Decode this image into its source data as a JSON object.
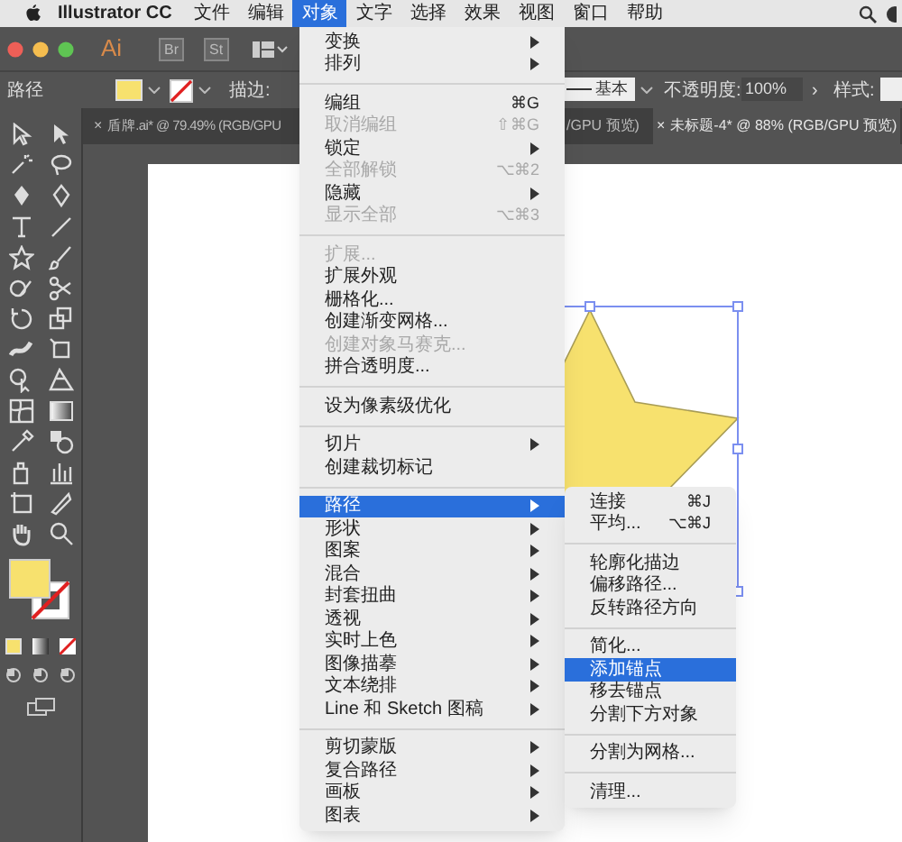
{
  "menu_bar": {
    "app_name": "Illustrator CC",
    "items": [
      {
        "label": "文件",
        "selected": false
      },
      {
        "label": "编辑",
        "selected": false
      },
      {
        "label": "对象",
        "selected": true
      },
      {
        "label": "文字",
        "selected": false
      },
      {
        "label": "选择",
        "selected": false
      },
      {
        "label": "效果",
        "selected": false
      },
      {
        "label": "视图",
        "selected": false
      },
      {
        "label": "窗口",
        "selected": false
      },
      {
        "label": "帮助",
        "selected": false
      }
    ]
  },
  "app_bar": {
    "logo": "Ai",
    "bridge": "Br",
    "stock": "St"
  },
  "control_bar": {
    "selection_label": "路径",
    "stroke_label": "描边:",
    "stroke_profile": "基本",
    "opacity_label": "不透明度:",
    "opacity_value": "100%",
    "more": "›",
    "style_label": "样式:"
  },
  "document_tabs": [
    {
      "close": "×",
      "label": "盾牌.ai* @ 79.49% (RGB/GPU",
      "label_after_menu": "/GPU 预览)",
      "selected": false
    },
    {
      "close": "×",
      "label": "未标题-4* @ 88% (RGB/GPU 预览)",
      "selected": true
    }
  ],
  "object_menu": {
    "groups": [
      [
        {
          "label": "变换",
          "submenu": true,
          "disabled": false,
          "selected": false
        },
        {
          "label": "排列",
          "submenu": true,
          "disabled": false,
          "selected": false
        }
      ],
      [
        {
          "label": "编组",
          "shortcut": "⌘G",
          "submenu": false,
          "disabled": false,
          "selected": false
        },
        {
          "label": "取消编组",
          "shortcut": "⇧⌘G",
          "submenu": false,
          "disabled": true,
          "selected": false
        },
        {
          "label": "锁定",
          "submenu": true,
          "disabled": false,
          "selected": false
        },
        {
          "label": "全部解锁",
          "shortcut": "⌥⌘2",
          "submenu": false,
          "disabled": true,
          "selected": false
        },
        {
          "label": "隐藏",
          "submenu": true,
          "disabled": false,
          "selected": false
        },
        {
          "label": "显示全部",
          "shortcut": "⌥⌘3",
          "submenu": false,
          "disabled": true,
          "selected": false
        }
      ],
      [
        {
          "label": "扩展...",
          "submenu": false,
          "disabled": true,
          "selected": false
        },
        {
          "label": "扩展外观",
          "submenu": false,
          "disabled": false,
          "selected": false
        },
        {
          "label": "栅格化...",
          "submenu": false,
          "disabled": false,
          "selected": false
        },
        {
          "label": "创建渐变网格...",
          "submenu": false,
          "disabled": false,
          "selected": false
        },
        {
          "label": "创建对象马赛克...",
          "submenu": false,
          "disabled": true,
          "selected": false
        },
        {
          "label": "拼合透明度...",
          "submenu": false,
          "disabled": false,
          "selected": false
        }
      ],
      [
        {
          "label": "设为像素级优化",
          "submenu": false,
          "disabled": false,
          "selected": false
        }
      ],
      [
        {
          "label": "切片",
          "submenu": true,
          "disabled": false,
          "selected": false
        },
        {
          "label": "创建裁切标记",
          "submenu": false,
          "disabled": false,
          "selected": false
        }
      ],
      [
        {
          "label": "路径",
          "submenu": true,
          "disabled": false,
          "selected": true
        },
        {
          "label": "形状",
          "submenu": true,
          "disabled": false,
          "selected": false
        },
        {
          "label": "图案",
          "submenu": true,
          "disabled": false,
          "selected": false
        },
        {
          "label": "混合",
          "submenu": true,
          "disabled": false,
          "selected": false
        },
        {
          "label": "封套扭曲",
          "submenu": true,
          "disabled": false,
          "selected": false
        },
        {
          "label": "透视",
          "submenu": true,
          "disabled": false,
          "selected": false
        },
        {
          "label": "实时上色",
          "submenu": true,
          "disabled": false,
          "selected": false
        },
        {
          "label": "图像描摹",
          "submenu": true,
          "disabled": false,
          "selected": false
        },
        {
          "label": "文本绕排",
          "submenu": true,
          "disabled": false,
          "selected": false
        },
        {
          "label": "Line 和 Sketch 图稿",
          "submenu": true,
          "disabled": false,
          "selected": false
        }
      ],
      [
        {
          "label": "剪切蒙版",
          "submenu": true,
          "disabled": false,
          "selected": false
        },
        {
          "label": "复合路径",
          "submenu": true,
          "disabled": false,
          "selected": false
        },
        {
          "label": "画板",
          "submenu": true,
          "disabled": false,
          "selected": false
        },
        {
          "label": "图表",
          "submenu": true,
          "disabled": false,
          "selected": false
        }
      ]
    ]
  },
  "path_submenu": {
    "groups": [
      [
        {
          "label": "连接",
          "shortcut": "⌘J",
          "selected": false
        },
        {
          "label": "平均...",
          "shortcut": "⌥⌘J",
          "selected": false
        }
      ],
      [
        {
          "label": "轮廓化描边",
          "selected": false
        },
        {
          "label": "偏移路径...",
          "selected": false
        },
        {
          "label": "反转路径方向",
          "selected": false
        }
      ],
      [
        {
          "label": "简化...",
          "selected": false
        },
        {
          "label": "添加锚点",
          "selected": true
        },
        {
          "label": "移去锚点",
          "selected": false
        },
        {
          "label": "分割下方对象",
          "selected": false
        }
      ],
      [
        {
          "label": "分割为网格...",
          "selected": false
        }
      ],
      [
        {
          "label": "清理...",
          "selected": false
        }
      ]
    ]
  }
}
